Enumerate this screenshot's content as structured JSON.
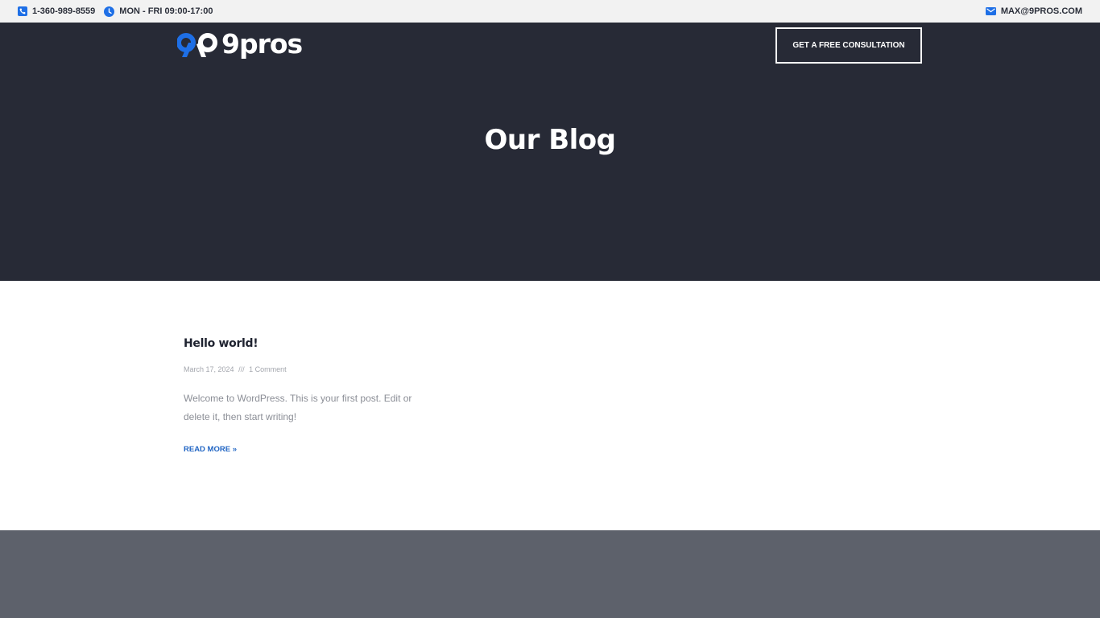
{
  "topbar": {
    "phone": {
      "icon": "phone-icon",
      "text": "1-360-989-8559"
    },
    "hours": {
      "icon": "clock-icon",
      "text": "MON - FRI 09:00-17:00"
    },
    "email": {
      "icon": "mail-icon",
      "text": "MAX@9PROS.COM"
    }
  },
  "header": {
    "logo_text": "9pros",
    "cta_label": "GET A FREE CONSULTATION"
  },
  "hero": {
    "title": "Our Blog"
  },
  "posts": [
    {
      "title": "Hello world!",
      "date": "March 17, 2024",
      "separator": "///",
      "comments": "1 Comment",
      "excerpt": "Welcome to WordPress. This is your first post. Edit or delete it, then start writing!",
      "read_more": "READ MORE »"
    }
  ],
  "colors": {
    "accent": "#1e6fe6",
    "hero_bg": "#272a36",
    "topbar_bg": "#f2f2f2",
    "footer_bg": "#5d616b",
    "link": "#2266c4"
  }
}
